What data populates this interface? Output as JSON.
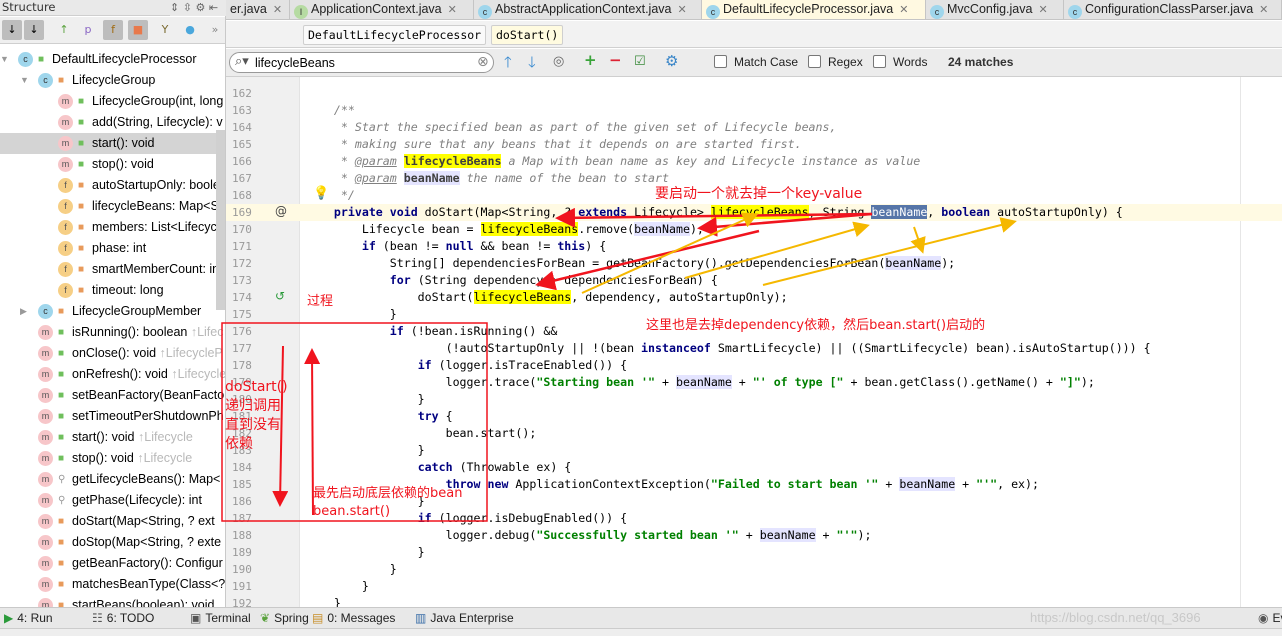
{
  "structure": {
    "title": "Structure",
    "items": [
      {
        "label": "DefaultLifecycleProcessor",
        "icon": "c",
        "vis": "pub",
        "indent": 0,
        "expand": "open"
      },
      {
        "label": "LifecycleGroup",
        "icon": "c",
        "vis": "priv",
        "indent": 1,
        "expand": "open"
      },
      {
        "label": "LifecycleGroup(int, long",
        "icon": "m",
        "vis": "pub",
        "indent": 2
      },
      {
        "label": "add(String, Lifecycle): v",
        "icon": "m",
        "vis": "pub",
        "indent": 2
      },
      {
        "label": "start(): void",
        "icon": "m",
        "vis": "pub",
        "indent": 2,
        "selected": true
      },
      {
        "label": "stop(): void",
        "icon": "m",
        "vis": "pub",
        "indent": 2
      },
      {
        "label": "autoStartupOnly: boole",
        "icon": "f",
        "vis": "priv",
        "indent": 2
      },
      {
        "label": "lifecycleBeans: Map<St",
        "icon": "f",
        "vis": "priv",
        "indent": 2
      },
      {
        "label": "members: List<Lifecycl",
        "icon": "f",
        "vis": "priv",
        "indent": 2
      },
      {
        "label": "phase: int",
        "icon": "f",
        "vis": "priv",
        "indent": 2
      },
      {
        "label": "smartMemberCount: in",
        "icon": "f",
        "vis": "priv",
        "indent": 2
      },
      {
        "label": "timeout: long",
        "icon": "f",
        "vis": "priv",
        "indent": 2
      },
      {
        "label": "LifecycleGroupMember",
        "icon": "c",
        "vis": "priv",
        "indent": 1,
        "expand": "closed"
      },
      {
        "label": "isRunning(): boolean",
        "suffix": " ↑Lifec",
        "icon": "m",
        "vis": "pub",
        "indent": 1
      },
      {
        "label": "onClose(): void",
        "suffix": " ↑LifecycleP",
        "icon": "m",
        "vis": "pub",
        "indent": 1
      },
      {
        "label": "onRefresh(): void",
        "suffix": " ↑Lifecycle",
        "icon": "m",
        "vis": "pub",
        "indent": 1
      },
      {
        "label": "setBeanFactory(BeanFacto",
        "icon": "m",
        "vis": "pub",
        "indent": 1
      },
      {
        "label": "setTimeoutPerShutdownPh",
        "icon": "m",
        "vis": "pub",
        "indent": 1
      },
      {
        "label": "start(): void",
        "suffix": " ↑Lifecycle",
        "icon": "m",
        "vis": "pub",
        "indent": 1
      },
      {
        "label": "stop(): void",
        "suffix": " ↑Lifecycle",
        "icon": "m",
        "vis": "pub",
        "indent": 1
      },
      {
        "label": "getLifecycleBeans(): Map<",
        "icon": "m",
        "vis": "pkg",
        "indent": 1
      },
      {
        "label": "getPhase(Lifecycle): int",
        "icon": "m",
        "vis": "pkg",
        "indent": 1
      },
      {
        "label": "doStart(Map<String, ? ext",
        "icon": "m",
        "vis": "priv",
        "indent": 1
      },
      {
        "label": "doStop(Map<String, ? exte",
        "icon": "m",
        "vis": "priv",
        "indent": 1
      },
      {
        "label": "getBeanFactory(): Configur",
        "icon": "m",
        "vis": "priv",
        "indent": 1
      },
      {
        "label": "matchesBeanType(Class<?",
        "icon": "m",
        "vis": "priv",
        "indent": 1
      },
      {
        "label": "startBeans(boolean): void",
        "icon": "m",
        "vis": "priv",
        "indent": 1
      }
    ]
  },
  "tabs": [
    {
      "label": "er.java",
      "icon": "",
      "active": false
    },
    {
      "label": "ApplicationContext.java",
      "icon": "i",
      "active": false
    },
    {
      "label": "AbstractApplicationContext.java",
      "icon": "c",
      "active": false
    },
    {
      "label": "DefaultLifecycleProcessor.java",
      "icon": "c",
      "active": true
    },
    {
      "label": "MvcConfig.java",
      "icon": "c",
      "active": false
    },
    {
      "label": "ConfigurationClassParser.java",
      "icon": "c",
      "active": false
    }
  ],
  "breadcrumb": [
    "DefaultLifecycleProcessor",
    "doStart()"
  ],
  "search": {
    "value": "lifecycleBeans",
    "match_case": "Match Case",
    "regex": "Regex",
    "words": "Words",
    "matches": "24 matches"
  },
  "code": {
    "first_line": 162,
    "current_line": 169,
    "highlight_word": "lifecycleBeans",
    "param_word": "beanName",
    "lines": [
      "",
      "    /**",
      "     * Start the specified bean as part of the given set of Lifecycle beans,",
      "     * making sure that any beans that it depends on are started first.",
      "     * @param lifecycleBeans a Map with bean name as key and Lifecycle instance as value",
      "     * @param beanName the name of the bean to start",
      "     */",
      "    private void doStart(Map<String, ? extends Lifecycle> lifecycleBeans, String beanName, boolean autoStartupOnly) {",
      "        Lifecycle bean = lifecycleBeans.remove(beanName);",
      "        if (bean != null && bean != this) {",
      "            String[] dependenciesForBean = getBeanFactory().getDependenciesForBean(beanName);",
      "            for (String dependency : dependenciesForBean) {",
      "                doStart(lifecycleBeans, dependency, autoStartupOnly);",
      "            }",
      "            if (!bean.isRunning() &&",
      "                    (!autoStartupOnly || !(bean instanceof SmartLifecycle) || ((SmartLifecycle) bean).isAutoStartup())) {",
      "                if (logger.isTraceEnabled()) {",
      "                    logger.trace(\"Starting bean '\" + beanName + \"' of type [\" + bean.getClass().getName() + \"]\");",
      "                }",
      "                try {",
      "                    bean.start();",
      "                }",
      "                catch (Throwable ex) {",
      "                    throw new ApplicationContextException(\"Failed to start bean '\" + beanName + \"'\", ex);",
      "                }",
      "                if (logger.isDebugEnabled()) {",
      "                    logger.debug(\"Successfully started bean '\" + beanName + \"'\");",
      "                }",
      "            }",
      "        }",
      "    }"
    ]
  },
  "annotations": {
    "remove_note": "要启动一个就去掉一个key-value",
    "process_label": "过程",
    "dependency_note": "这里也是去掉dependency依赖，然后bean.start()启动的",
    "recursion_note": [
      "doStart()",
      "递归调用",
      "直到没有",
      "依赖"
    ],
    "bottom_note": [
      "最先启动底层依赖的bean",
      "bean.start()"
    ],
    "red": "#f0141e",
    "yellow": "#f5b800"
  },
  "bottom_tools": [
    {
      "label": "4: Run",
      "icon": "run-icon"
    },
    {
      "label": "6: TODO",
      "icon": "todo-icon"
    },
    {
      "label": "Terminal",
      "icon": "terminal-icon"
    },
    {
      "label": "Spring",
      "icon": "spring-icon"
    },
    {
      "label": "0: Messages",
      "icon": "messages-icon"
    },
    {
      "label": "Java Enterprise",
      "icon": "java-enterprise-icon"
    },
    {
      "label": "Event",
      "icon": "event-log-icon"
    }
  ],
  "watermark": "https://blog.csdn.net/qq_3696"
}
